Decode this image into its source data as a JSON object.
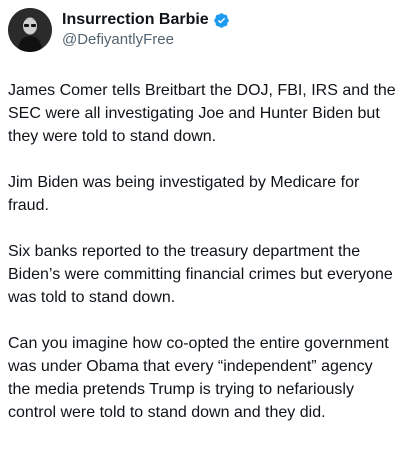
{
  "author": {
    "display_name": "Insurrection Barbie",
    "handle": "@DefiyantlyFree",
    "verified_icon": "verified-badge-icon",
    "verified_color": "#1d9bf0"
  },
  "tweet": {
    "paragraphs": [
      "James Comer tells Breitbart the DOJ, FBI, IRS and the SEC were all investigating Joe and Hunter Biden but they were told to stand down.",
      "Jim Biden was being investigated by Medicare for fraud.",
      "Six banks reported to the treasury department the Biden’s were committing financial crimes but everyone was told to stand down.",
      "Can you imagine how co-opted the entire government was under Obama that every “independent” agency the media pretends Trump is trying to nefariously control were told to stand down and they did."
    ]
  }
}
